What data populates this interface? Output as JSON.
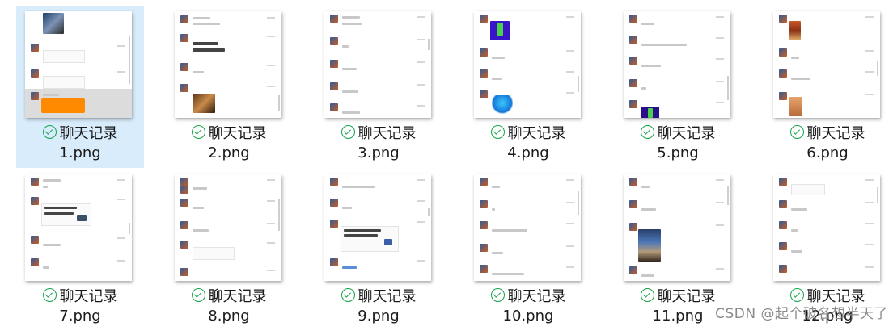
{
  "files": [
    {
      "title": "聊天记录",
      "name": "1.png",
      "selected": true
    },
    {
      "title": "聊天记录",
      "name": "2.png",
      "selected": false
    },
    {
      "title": "聊天记录",
      "name": "3.png",
      "selected": false
    },
    {
      "title": "聊天记录",
      "name": "4.png",
      "selected": false
    },
    {
      "title": "聊天记录",
      "name": "5.png",
      "selected": false
    },
    {
      "title": "聊天记录",
      "name": "6.png",
      "selected": false
    },
    {
      "title": "聊天记录",
      "name": "7.png",
      "selected": false
    },
    {
      "title": "聊天记录",
      "name": "8.png",
      "selected": false
    },
    {
      "title": "聊天记录",
      "name": "9.png",
      "selected": false
    },
    {
      "title": "聊天记录",
      "name": "10.png",
      "selected": false
    },
    {
      "title": "聊天记录",
      "name": "11.png",
      "selected": false
    },
    {
      "title": "聊天记录",
      "name": "12.png",
      "selected": false
    }
  ],
  "icons": {
    "status": "check-circle-icon"
  },
  "colors": {
    "selection": "#d8ecfb",
    "status": "#16a34a",
    "accent": "#ff8a00"
  },
  "watermark": "CSDN @起个破名想半天了"
}
